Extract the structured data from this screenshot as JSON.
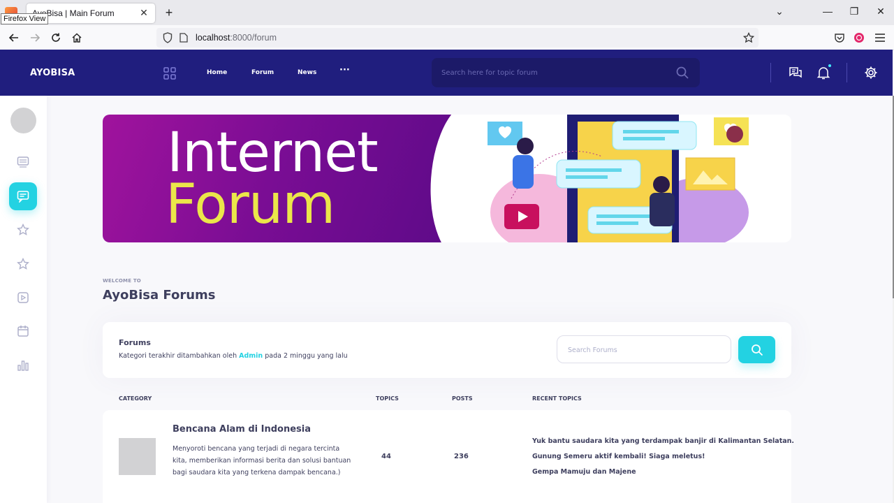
{
  "browser": {
    "tooltip": "Firefox View",
    "tab_title": "AyoBisa | Main Forum",
    "tab_close": "✕",
    "new_tab": "+",
    "url_host": "localhost",
    "url_path": ":8000/forum",
    "window_controls": [
      "⌄",
      "—",
      "❐",
      "✕"
    ]
  },
  "header": {
    "logo": "AYOBISA",
    "nav": [
      "Home",
      "Forum",
      "News"
    ],
    "more": "···",
    "search_placeholder": "Search here for topic forum"
  },
  "banner": {
    "line1": "Internet",
    "line2": "Forum"
  },
  "welcome": {
    "pretitle": "WELCOME TO",
    "title": "AyoBisa Forums"
  },
  "forums_box": {
    "title": "Forums",
    "text_before": "Kategori terakhir ditambahkan oleh ",
    "admin": "Admin",
    "text_after": " pada 2 minggu yang lalu",
    "search_placeholder": "Search Forums"
  },
  "table": {
    "headers": [
      "CATEGORY",
      "TOPICS",
      "POSTS",
      "RECENT TOPICS"
    ],
    "rows": [
      {
        "title": "Bencana Alam di Indonesia",
        "description": "Menyoroti bencana yang terjadi di negara tercinta kita, memberikan informasi berita dan solusi bantuan bagi saudara kita yang terkena dampak bencana.)",
        "topics": "44",
        "posts": "236",
        "recent": [
          "Yuk bantu saudara kita yang terdampak banjir di Kalimantan Selatan.",
          "Gunung Semeru aktif kembali! Siaga meletus!",
          "Gempa Mamuju dan Majene"
        ]
      }
    ]
  },
  "colors": {
    "header_bg": "#201e7e",
    "accent": "#23d2e2",
    "text": "#3e3f5e"
  }
}
